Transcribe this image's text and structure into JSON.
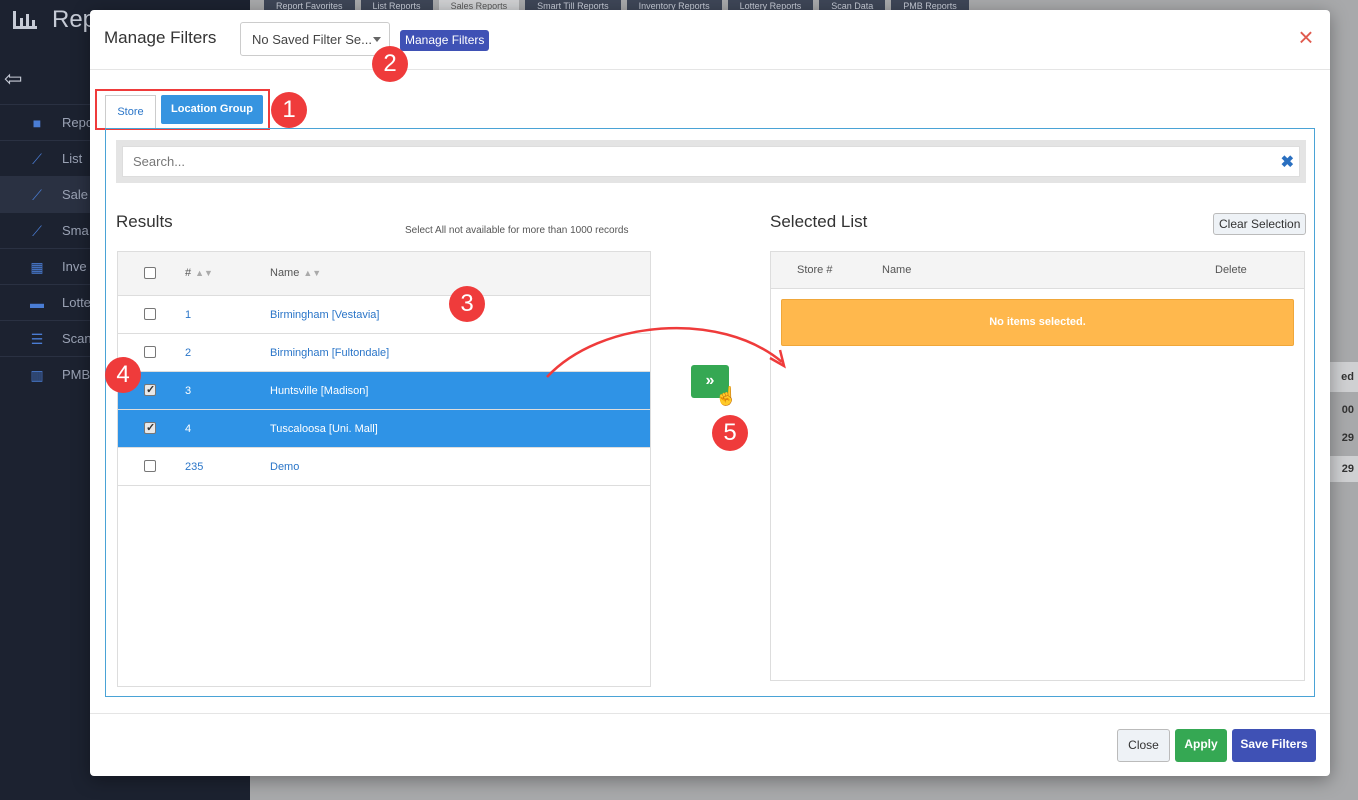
{
  "background": {
    "brand": "Rep",
    "nav": [
      {
        "label": "Repo",
        "icon": "bookmark-icon"
      },
      {
        "label": "List",
        "icon": "line-chart-icon"
      },
      {
        "label": "Sale",
        "icon": "line-chart-icon"
      },
      {
        "label": "Sma",
        "icon": "line-chart-icon"
      },
      {
        "label": "Inve",
        "icon": "inventory-icon"
      },
      {
        "label": "Lotte",
        "icon": "ticket-icon"
      },
      {
        "label": "Scan",
        "icon": "list-icon"
      },
      {
        "label": "PMB",
        "icon": "bar-chart-icon"
      }
    ],
    "tabs": [
      "Report Favorites",
      "List Reports",
      "Sales Reports",
      "Smart Till Reports",
      "Inventory Reports",
      "Lottery Reports",
      "Scan Data",
      "PMB Reports"
    ],
    "right_fragments": [
      "ed",
      "00",
      "29",
      "29"
    ]
  },
  "modal": {
    "title": "Manage Filters",
    "saved_filter": "No Saved Filter Se...",
    "manage_label": "Manage Filters",
    "close_icon": "×",
    "tabs": {
      "store": "Store",
      "location_group": "Location Group"
    },
    "search_placeholder": "Search...",
    "search_clear": "✖",
    "results": {
      "title": "Results",
      "note": "Select All not available for more than 1000 records",
      "columns": {
        "num": "#",
        "name": "Name"
      },
      "rows": [
        {
          "num": "1",
          "name": "Birmingham [Vestavia]",
          "checked": false
        },
        {
          "num": "2",
          "name": "Birmingham [Fultondale]",
          "checked": false
        },
        {
          "num": "3",
          "name": "Huntsville [Madison]",
          "checked": true
        },
        {
          "num": "4",
          "name": "Tuscaloosa [Uni. Mall]",
          "checked": true
        },
        {
          "num": "235",
          "name": "Demo",
          "checked": false
        }
      ]
    },
    "move_label": "»",
    "selected": {
      "title": "Selected List",
      "clear_label": "Clear Selection",
      "columns": {
        "store": "Store #",
        "name": "Name",
        "delete": "Delete"
      },
      "empty": "No items selected."
    },
    "footer": {
      "close": "Close",
      "apply": "Apply",
      "save": "Save Filters"
    }
  },
  "annotations": [
    "1",
    "2",
    "3",
    "4",
    "5"
  ],
  "colors": {
    "accent": "#3694e0",
    "success": "#35a853",
    "primary": "#3f51b5",
    "warning": "#ffb84d",
    "annotation": "#ef3b3b"
  }
}
